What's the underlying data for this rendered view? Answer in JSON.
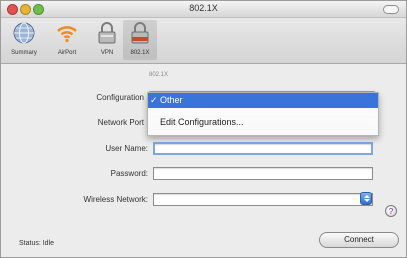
{
  "window": {
    "title": "802.1X"
  },
  "toolbar": {
    "items": [
      {
        "label": "Summary",
        "icon": "network-globe-icon"
      },
      {
        "label": "AirPort",
        "icon": "airport-wifi-icon"
      },
      {
        "label": "VPN",
        "icon": "vpn-lock-icon"
      },
      {
        "label": "802.1X",
        "icon": "802-1x-lock-icon",
        "selected": true
      }
    ]
  },
  "form": {
    "frame_label": "802.1X",
    "configuration_label": "Configuration",
    "network_port_label": "Network Port",
    "user_name_label": "User Name:",
    "user_name_value": "",
    "password_label": "Password:",
    "password_value": "",
    "wireless_network_label": "Wireless Network:",
    "wireless_network_value": ""
  },
  "menu": {
    "selected": "Other",
    "check": "✓",
    "edit": "Edit Configurations..."
  },
  "footer": {
    "status": "Status: Idle",
    "connect_button": "Connect",
    "help_glyph": "?"
  },
  "colors": {
    "selection_blue": "#3a74d9",
    "window_background": "#ececec"
  }
}
